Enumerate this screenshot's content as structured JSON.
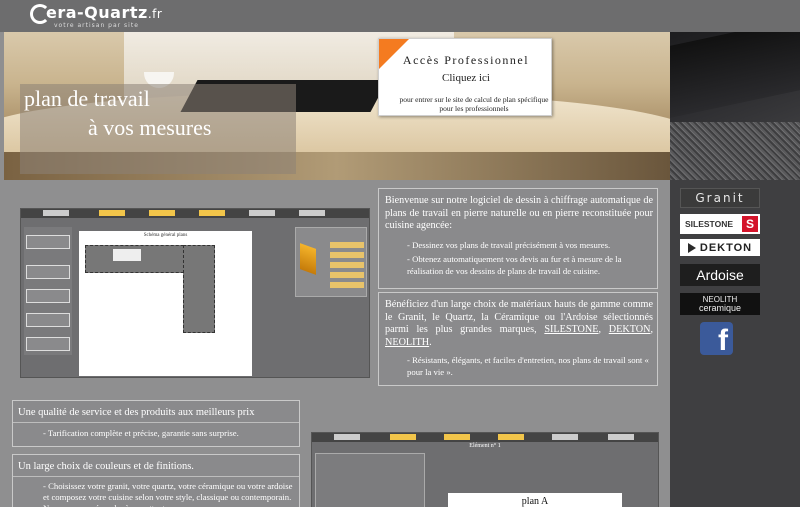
{
  "header": {
    "logo_text": "era-Quartz",
    "logo_tld": ".fr",
    "logo_tagline": "votre artisan par site"
  },
  "hero": {
    "headline_line1": "plan de travail",
    "headline_line2": "à vos mesures"
  },
  "pro_box": {
    "title": "Accès Professionnel",
    "link": "Cliquez ici",
    "description": "pour entrer sur le site de calcul de plan spécifique pour les professionnels"
  },
  "brands": {
    "granit": "Granit",
    "silestone": "SILESTONE",
    "dekton": "DEKTON",
    "ardoise": "Ardoise",
    "neolith_1": "NEOLITH",
    "neolith_2": "ceramique",
    "facebook": "f"
  },
  "intro": {
    "lead": "Bienvenue sur notre logiciel de dessin à chiffrage automatique de plans de travail en pierre naturelle ou en pierre reconstituée pour cuisine agencée:",
    "bullet_1": "- Dessinez vos plans de travail précisément à vos mesures.",
    "bullet_2": "- Obtenez automatiquement vos devis au fur et à mesure de la réalisation de vos dessins de plans de travail de cuisine."
  },
  "materials": {
    "lead_before": "Bénéficiez d'un large choix de matériaux hauts de gamme comme le Granit, le Quartz, la Céramique ou l'Ardoise sélectionnés parmi les plus grandes marques, ",
    "link_silestone": "SILESTONE",
    "sep_1": ", ",
    "link_dekton": "DEKTON",
    "sep_2": ", ",
    "link_neolith": "NEOLITH",
    "lead_after": ".",
    "bullet": "- Résistants, élégants, et faciles d'entretien, nos plans de travail sont « pour la vie »."
  },
  "service": {
    "title": "Une qualité de service et des produits aux meilleurs prix",
    "line": "- Tarification complète et précise, garantie sans surprise."
  },
  "colors": {
    "title": "Un large choix de couleurs et de finitions.",
    "line": "- Choisissez votre granit, votre quartz, votre céramique ou votre ardoise et composez votre cuisine selon votre style, classique ou contemporain. Nous saurons répondre à vos attentes."
  },
  "preview_1": {
    "canvas_title": "Schéma général plans"
  },
  "preview_2": {
    "title": "Elément n° 1",
    "plan_label": "plan A"
  },
  "palette": {
    "accent": "#f47b20",
    "background": "#8f8f90",
    "facebook": "#3b5a9a",
    "silestone_red": "#d4142b"
  }
}
